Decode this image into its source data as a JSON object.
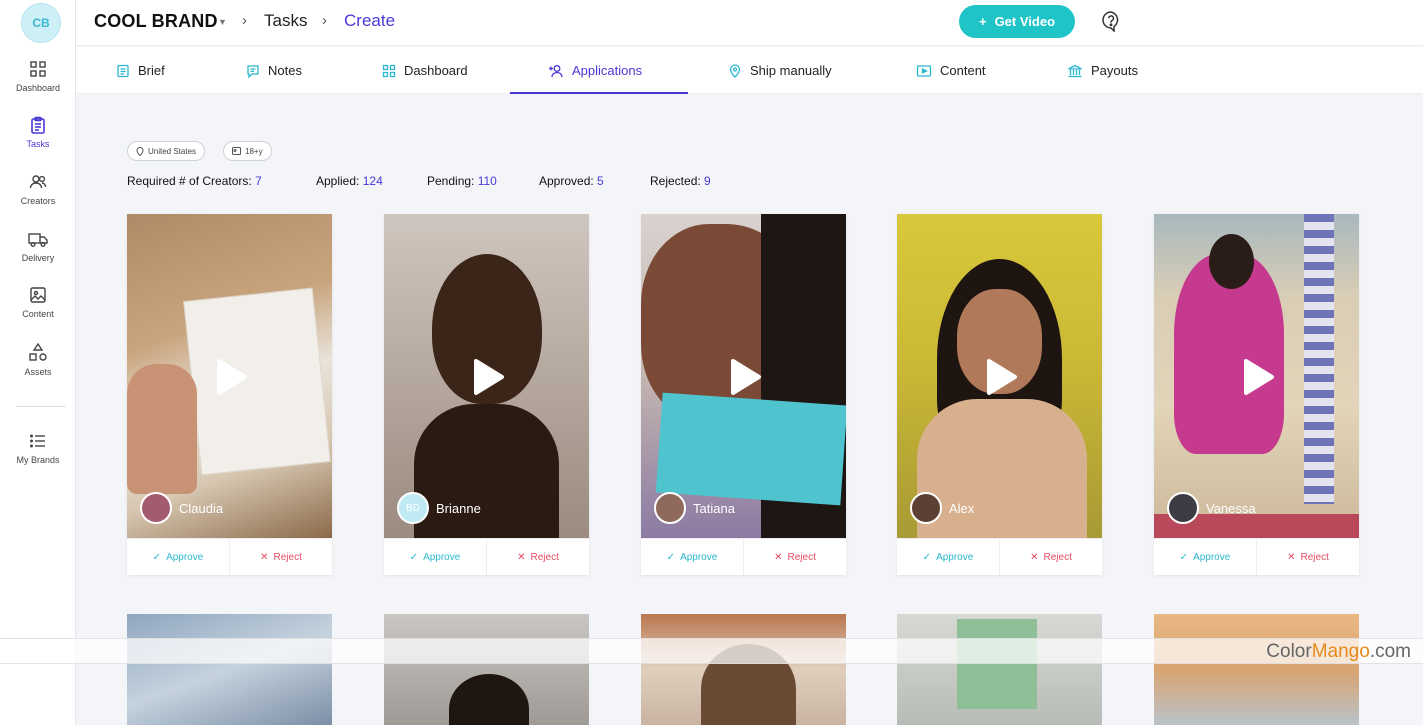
{
  "app": {
    "avatar_initials": "CB",
    "brand": "COOL BRAND",
    "breadcrumb": [
      "Tasks",
      "Create"
    ],
    "get_video_label": "Get Video",
    "accent": "#4a38d6",
    "teal": "#1fc4c7"
  },
  "sidebar": {
    "items": [
      {
        "label": "Dashboard",
        "icon": "grid-icon"
      },
      {
        "label": "Tasks",
        "icon": "clipboard-icon",
        "active": true
      },
      {
        "label": "Creators",
        "icon": "users-icon"
      },
      {
        "label": "Delivery",
        "icon": "truck-icon"
      },
      {
        "label": "Content",
        "icon": "image-icon"
      },
      {
        "label": "Assets",
        "icon": "shapes-icon"
      },
      {
        "label": "My Brands",
        "icon": "list-icon"
      }
    ]
  },
  "tabs": [
    {
      "label": "Brief",
      "icon": "document-icon"
    },
    {
      "label": "Notes",
      "icon": "notes-icon"
    },
    {
      "label": "Dashboard",
      "icon": "grid-icon"
    },
    {
      "label": "Applications",
      "icon": "add-user-icon",
      "active": true
    },
    {
      "label": "Ship manually",
      "icon": "map-pin-icon"
    },
    {
      "label": "Content",
      "icon": "play-screen-icon"
    },
    {
      "label": "Payouts",
      "icon": "bank-icon"
    }
  ],
  "filters": {
    "location": "United States",
    "age": "18+y"
  },
  "stats": {
    "required_label": "Required # of Creators:",
    "required": "7",
    "applied_label": "Applied:",
    "applied": "124",
    "pending_label": "Pending:",
    "pending": "110",
    "approved_label": "Approved:",
    "approved": "5",
    "rejected_label": "Rejected:",
    "rejected": "9"
  },
  "cards": [
    {
      "name": "Claudia",
      "approve": "Approve",
      "reject": "Reject"
    },
    {
      "name": "Brianne",
      "initials": "BD",
      "approve": "Approve",
      "reject": "Reject"
    },
    {
      "name": "Tatiana",
      "approve": "Approve",
      "reject": "Reject"
    },
    {
      "name": "Alex",
      "approve": "Approve",
      "reject": "Reject"
    },
    {
      "name": "Vanessa",
      "approve": "Approve",
      "reject": "Reject"
    }
  ],
  "watermark": {
    "part1": "Color",
    "part2": "Mango",
    "part3": ".com"
  }
}
